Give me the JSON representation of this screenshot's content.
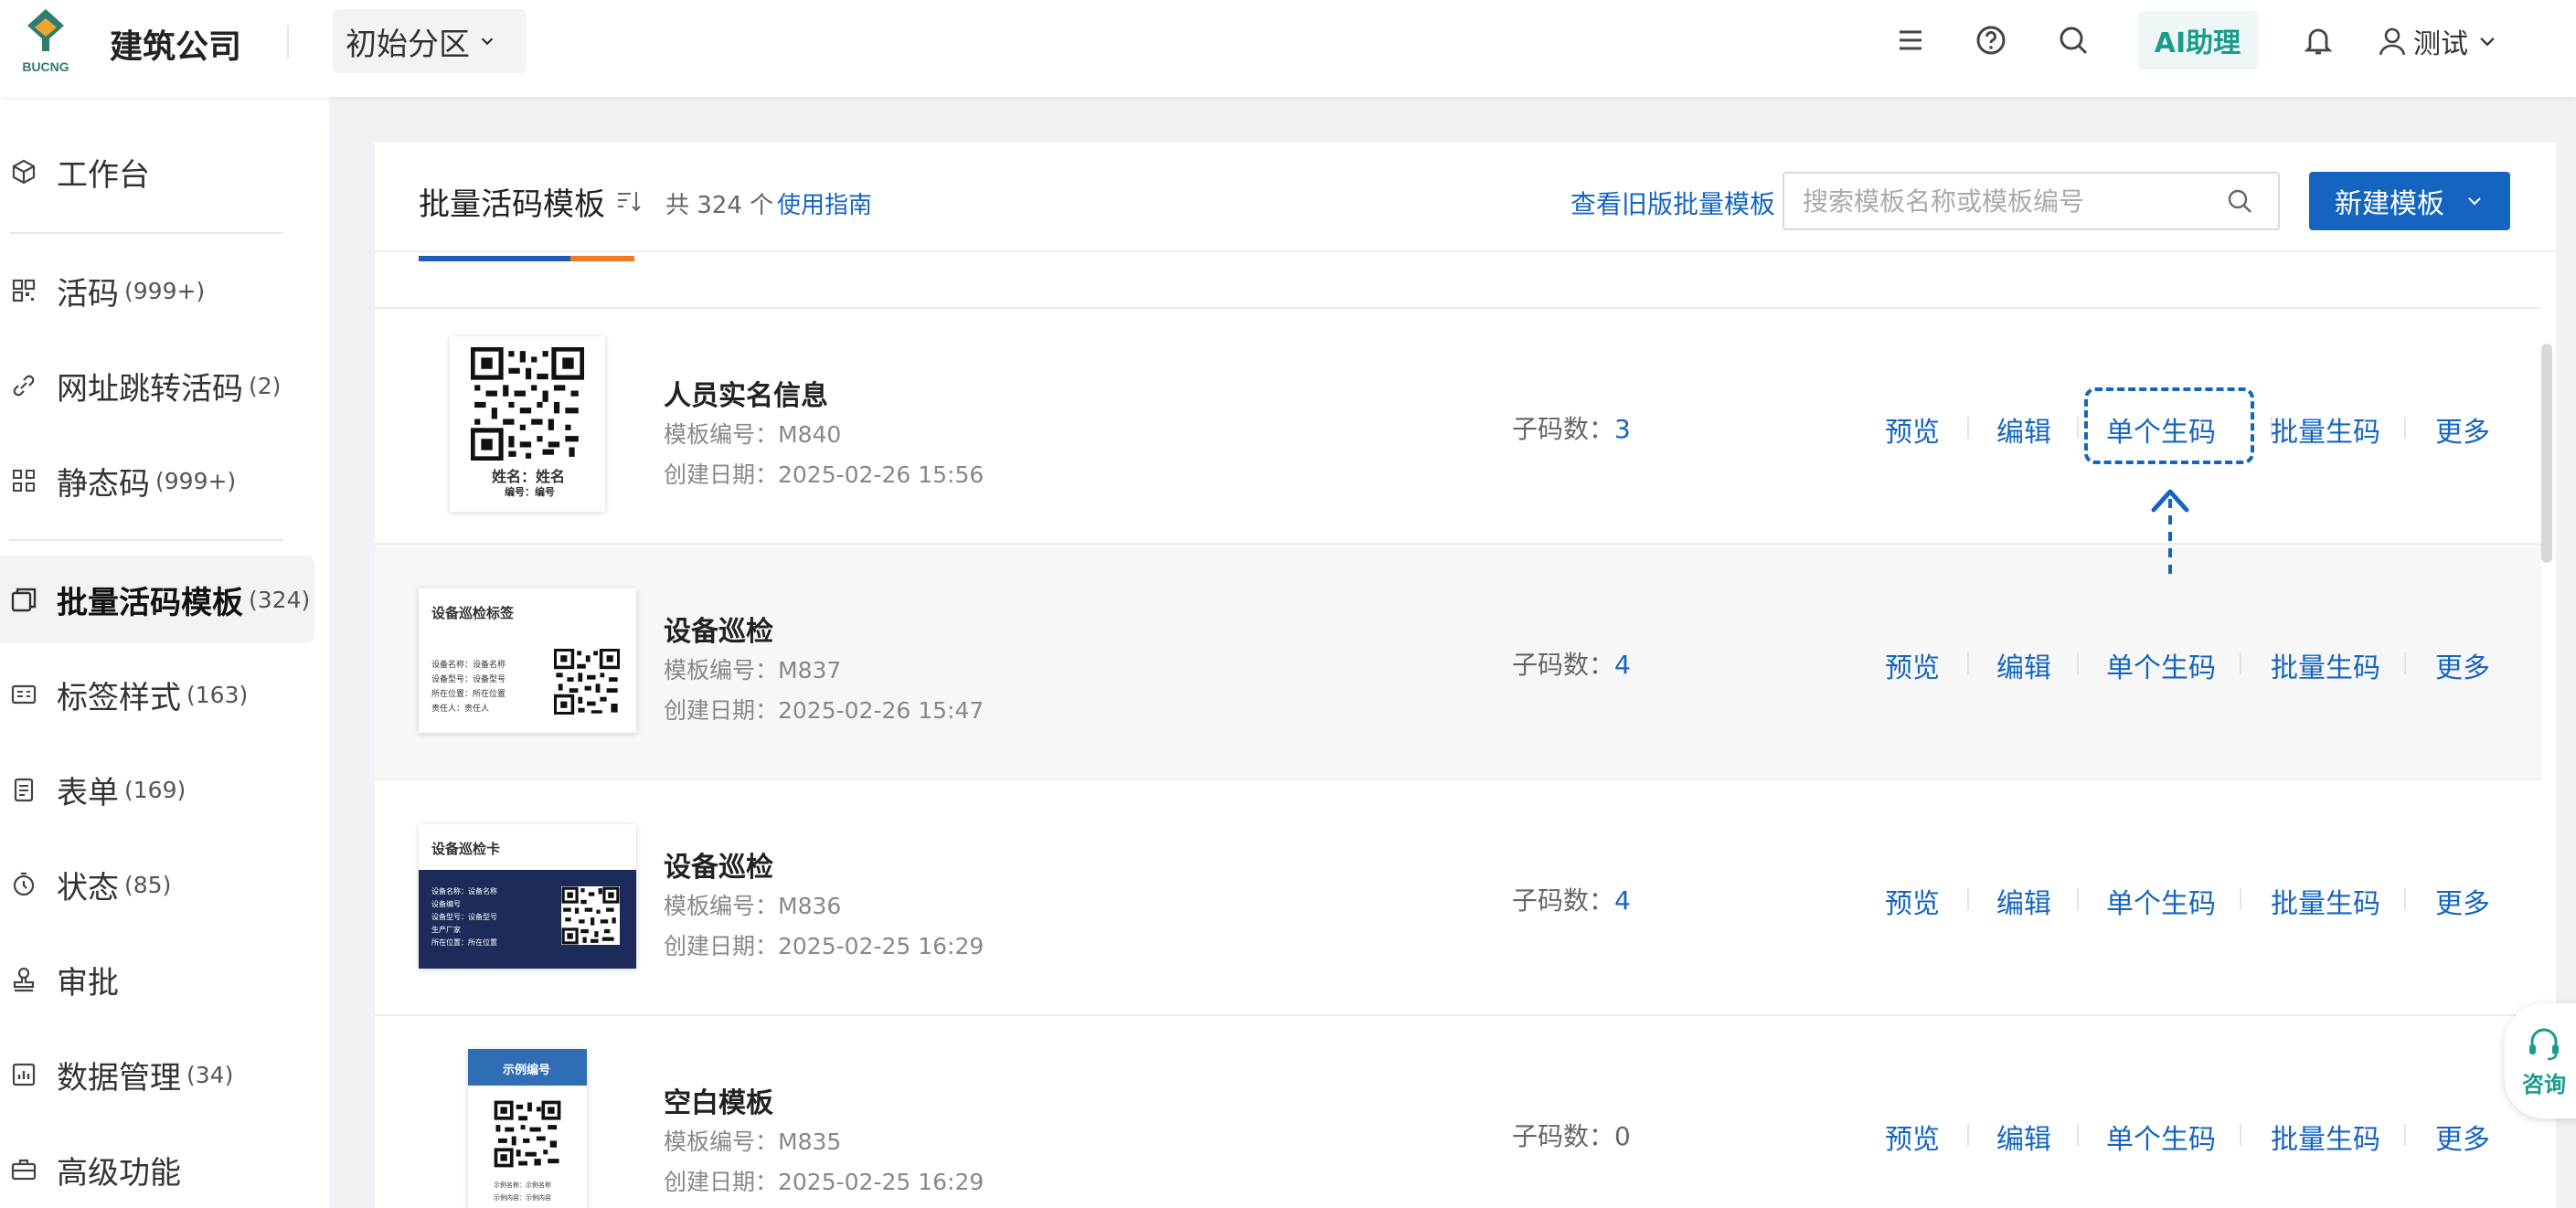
{
  "header": {
    "logo_text": "BUCNG",
    "company": "建筑公司",
    "partition": "初始分区",
    "ai_label": "AI助理",
    "user": "测试"
  },
  "sidebar": {
    "items": [
      {
        "label": "工作台",
        "count": "",
        "icon": "cube-icon"
      },
      {
        "label": "活码",
        "count": "(999+)",
        "icon": "qrcode-icon"
      },
      {
        "label": "网址跳转活码",
        "count": "(2)",
        "icon": "link-icon"
      },
      {
        "label": "静态码",
        "count": "(999+)",
        "icon": "static-code-icon"
      },
      {
        "label": "批量活码模板",
        "count": "(324)",
        "icon": "template-icon",
        "active": true
      },
      {
        "label": "标签样式",
        "count": "(163)",
        "icon": "label-icon"
      },
      {
        "label": "表单",
        "count": "(169)",
        "icon": "form-icon"
      },
      {
        "label": "状态",
        "count": "(85)",
        "icon": "status-icon"
      },
      {
        "label": "审批",
        "count": "",
        "icon": "stamp-icon"
      },
      {
        "label": "数据管理",
        "count": "(34)",
        "icon": "chart-icon"
      },
      {
        "label": "高级功能",
        "count": "",
        "icon": "briefcase-icon"
      }
    ]
  },
  "main": {
    "title": "批量活码模板",
    "total": "共 324 个",
    "guide": "使用指南",
    "old_link": "查看旧版批量模板",
    "search_placeholder": "搜索模板名称或模板编号",
    "new_button": "新建模板",
    "actions": {
      "preview": "预览",
      "edit": "编辑",
      "single": "单个生码",
      "batch": "批量生码",
      "more": "更多"
    },
    "sub_count_label": "子码数：",
    "rows": [
      {
        "name": "人员实名信息",
        "code": "模板编号：M840",
        "date": "创建日期：2025-02-26 15:56",
        "sub": "3",
        "thumb": {
          "line1": "姓名：姓名",
          "line2": "编号：编号"
        }
      },
      {
        "name": "设备巡检",
        "code": "模板编号：M837",
        "date": "创建日期：2025-02-26 15:47",
        "sub": "4",
        "thumb": {
          "title": "设备巡检标签",
          "lines": [
            "设备名称：设备名称",
            "设备型号：设备型号",
            "所在位置：所在位置",
            "责任人：责任人"
          ]
        }
      },
      {
        "name": "设备巡检",
        "code": "模板编号：M836",
        "date": "创建日期：2025-02-25 16:29",
        "sub": "4",
        "thumb": {
          "title": "设备巡检卡",
          "lines": [
            "设备名称：设备名称",
            "设备编号",
            "设备型号：设备型号",
            "生产厂家",
            "所在位置：所在位置"
          ]
        }
      },
      {
        "name": "空白模板",
        "code": "模板编号：M835",
        "date": "创建日期：2025-02-25 16:29",
        "sub": "0",
        "thumb": {
          "title": "示例编号",
          "lines": [
            "示例名称：示例名称",
            "示例内容：示例内容"
          ]
        }
      }
    ]
  },
  "consult": "咨询",
  "colors": {
    "accent": "#1565c0",
    "teal": "#1a9c8d",
    "orange": "#f07b23"
  }
}
